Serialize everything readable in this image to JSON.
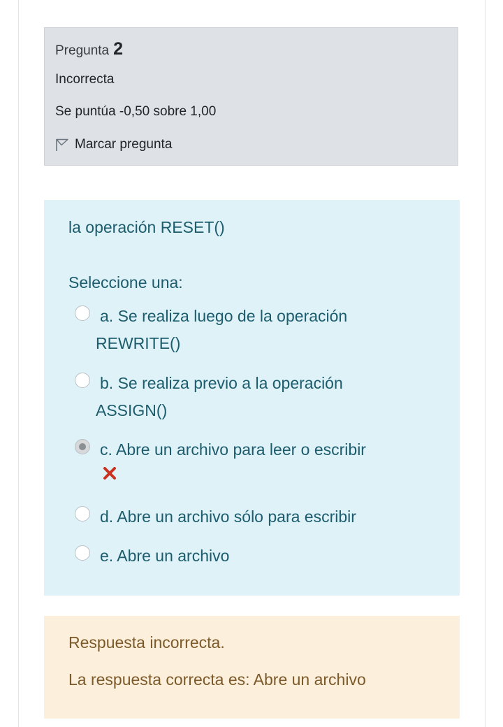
{
  "info": {
    "question_label": "Pregunta",
    "question_number": "2",
    "state": "Incorrecta",
    "grade": "Se puntúa -0,50 sobre 1,00",
    "flag_label": "Marcar pregunta"
  },
  "question": {
    "text": "la operación RESET()",
    "prompt": "Seleccione una:",
    "answers": [
      {
        "line1": "a. Se realiza luego de la operación",
        "line2": "REWRITE()",
        "checked": false
      },
      {
        "line1": "b. Se realiza previo a la operación",
        "line2": "ASSIGN()",
        "checked": false
      },
      {
        "line1": "c. Abre un archivo para leer o escribir",
        "line2": "",
        "checked": true,
        "marked_wrong": true
      },
      {
        "line1": "d. Abre un archivo sólo para escribir",
        "line2": "",
        "checked": false
      },
      {
        "line1": "e. Abre un archivo",
        "line2": "",
        "checked": false
      }
    ]
  },
  "feedback": {
    "result": "Respuesta incorrecta.",
    "correct_answer": "La respuesta correcta es: Abre un archivo"
  },
  "colors": {
    "info_bg": "#dee2e6",
    "question_bg": "#def2f8",
    "question_text": "#1c5c6d",
    "feedback_bg": "#fcefdc",
    "feedback_text": "#7d5a29",
    "wrong_mark": "#ca3120"
  },
  "icons": {
    "flag": "flag-outline-icon",
    "wrong": "cross-icon"
  }
}
